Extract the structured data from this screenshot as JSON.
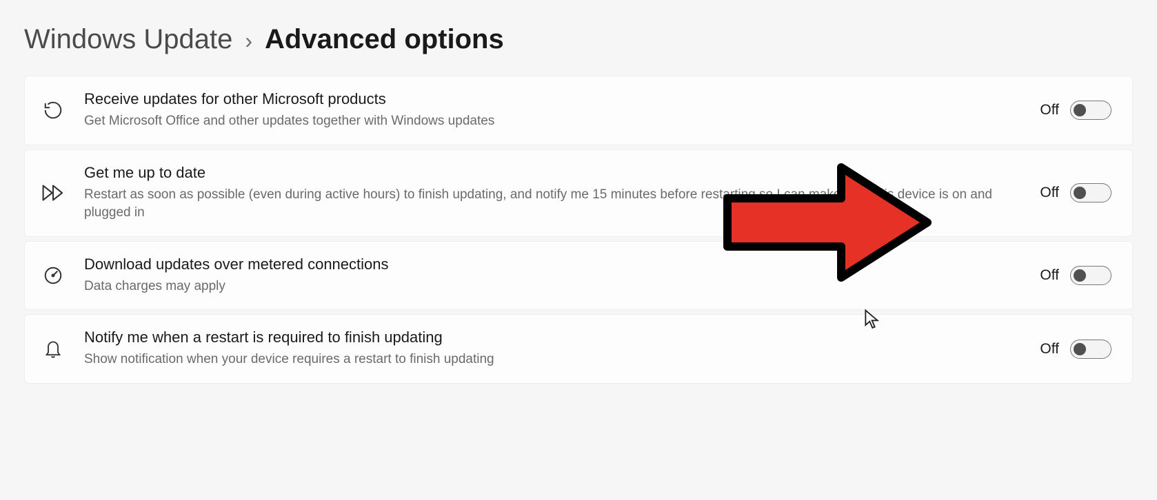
{
  "breadcrumb": {
    "parent": "Windows Update",
    "separator": "›",
    "current": "Advanced options"
  },
  "settings": [
    {
      "icon": "history-icon",
      "title": "Receive updates for other Microsoft products",
      "description": "Get Microsoft Office and other updates together with Windows updates",
      "state": "Off"
    },
    {
      "icon": "fast-forward-icon",
      "title": "Get me up to date",
      "description": "Restart as soon as possible (even during active hours) to finish updating, and notify me 15 minutes before restarting so I can make sure this device is on and plugged in",
      "state": "Off"
    },
    {
      "icon": "gauge-icon",
      "title": "Download updates over metered connections",
      "description": "Data charges may apply",
      "state": "Off"
    },
    {
      "icon": "bell-icon",
      "title": "Notify me when a restart is required to finish updating",
      "description": "Show notification when your device requires a restart to finish updating",
      "state": "Off"
    }
  ]
}
